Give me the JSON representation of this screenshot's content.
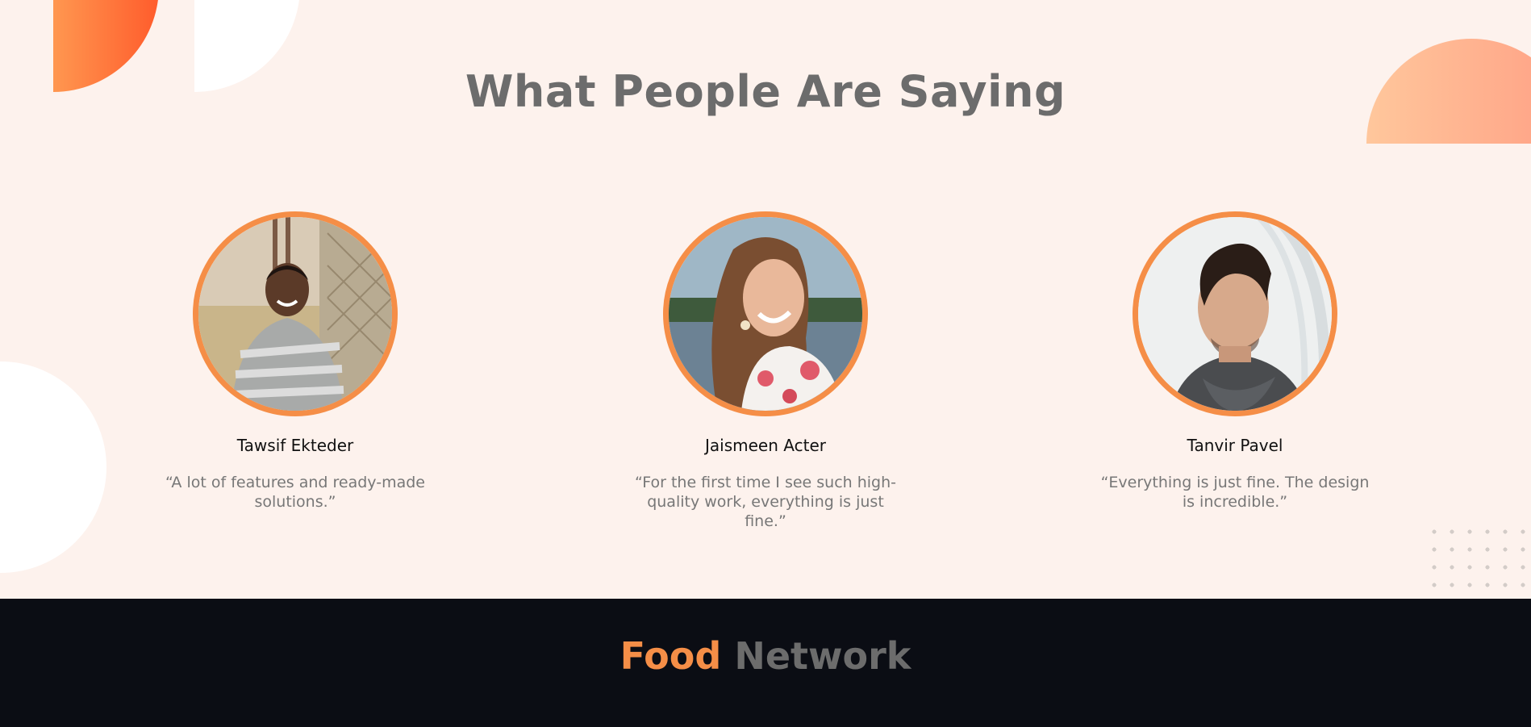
{
  "section": {
    "title": "What People Are Saying"
  },
  "testimonials": [
    {
      "name": "Tawsif Ekteder",
      "quote": "“A lot of features and ready-made solutions.”"
    },
    {
      "name": "Jaismeen Acter",
      "quote": "“For the first time I see such high-quality work, everything is just fine.”"
    },
    {
      "name": "Tanvir Pavel",
      "quote": "“Everything is just fine. The design is incredible.”"
    }
  ],
  "footer": {
    "brand_accent": "Food",
    "brand_rest": "Network"
  },
  "colors": {
    "accent": "#f58e47",
    "background": "#fdf2ed",
    "footer_bg": "#0b0d14",
    "title_text": "#6c6c6c"
  }
}
